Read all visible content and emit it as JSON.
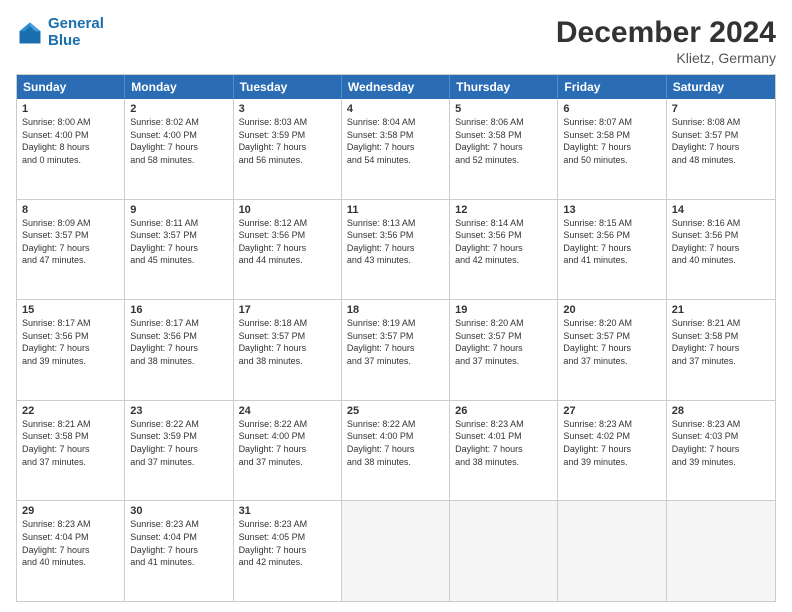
{
  "header": {
    "logo_line1": "General",
    "logo_line2": "Blue",
    "month": "December 2024",
    "location": "Klietz, Germany"
  },
  "days_of_week": [
    "Sunday",
    "Monday",
    "Tuesday",
    "Wednesday",
    "Thursday",
    "Friday",
    "Saturday"
  ],
  "weeks": [
    [
      {
        "day": "1",
        "lines": [
          "Sunrise: 8:00 AM",
          "Sunset: 4:00 PM",
          "Daylight: 8 hours",
          "and 0 minutes."
        ]
      },
      {
        "day": "2",
        "lines": [
          "Sunrise: 8:02 AM",
          "Sunset: 4:00 PM",
          "Daylight: 7 hours",
          "and 58 minutes."
        ]
      },
      {
        "day": "3",
        "lines": [
          "Sunrise: 8:03 AM",
          "Sunset: 3:59 PM",
          "Daylight: 7 hours",
          "and 56 minutes."
        ]
      },
      {
        "day": "4",
        "lines": [
          "Sunrise: 8:04 AM",
          "Sunset: 3:58 PM",
          "Daylight: 7 hours",
          "and 54 minutes."
        ]
      },
      {
        "day": "5",
        "lines": [
          "Sunrise: 8:06 AM",
          "Sunset: 3:58 PM",
          "Daylight: 7 hours",
          "and 52 minutes."
        ]
      },
      {
        "day": "6",
        "lines": [
          "Sunrise: 8:07 AM",
          "Sunset: 3:58 PM",
          "Daylight: 7 hours",
          "and 50 minutes."
        ]
      },
      {
        "day": "7",
        "lines": [
          "Sunrise: 8:08 AM",
          "Sunset: 3:57 PM",
          "Daylight: 7 hours",
          "and 48 minutes."
        ]
      }
    ],
    [
      {
        "day": "8",
        "lines": [
          "Sunrise: 8:09 AM",
          "Sunset: 3:57 PM",
          "Daylight: 7 hours",
          "and 47 minutes."
        ]
      },
      {
        "day": "9",
        "lines": [
          "Sunrise: 8:11 AM",
          "Sunset: 3:57 PM",
          "Daylight: 7 hours",
          "and 45 minutes."
        ]
      },
      {
        "day": "10",
        "lines": [
          "Sunrise: 8:12 AM",
          "Sunset: 3:56 PM",
          "Daylight: 7 hours",
          "and 44 minutes."
        ]
      },
      {
        "day": "11",
        "lines": [
          "Sunrise: 8:13 AM",
          "Sunset: 3:56 PM",
          "Daylight: 7 hours",
          "and 43 minutes."
        ]
      },
      {
        "day": "12",
        "lines": [
          "Sunrise: 8:14 AM",
          "Sunset: 3:56 PM",
          "Daylight: 7 hours",
          "and 42 minutes."
        ]
      },
      {
        "day": "13",
        "lines": [
          "Sunrise: 8:15 AM",
          "Sunset: 3:56 PM",
          "Daylight: 7 hours",
          "and 41 minutes."
        ]
      },
      {
        "day": "14",
        "lines": [
          "Sunrise: 8:16 AM",
          "Sunset: 3:56 PM",
          "Daylight: 7 hours",
          "and 40 minutes."
        ]
      }
    ],
    [
      {
        "day": "15",
        "lines": [
          "Sunrise: 8:17 AM",
          "Sunset: 3:56 PM",
          "Daylight: 7 hours",
          "and 39 minutes."
        ]
      },
      {
        "day": "16",
        "lines": [
          "Sunrise: 8:17 AM",
          "Sunset: 3:56 PM",
          "Daylight: 7 hours",
          "and 38 minutes."
        ]
      },
      {
        "day": "17",
        "lines": [
          "Sunrise: 8:18 AM",
          "Sunset: 3:57 PM",
          "Daylight: 7 hours",
          "and 38 minutes."
        ]
      },
      {
        "day": "18",
        "lines": [
          "Sunrise: 8:19 AM",
          "Sunset: 3:57 PM",
          "Daylight: 7 hours",
          "and 37 minutes."
        ]
      },
      {
        "day": "19",
        "lines": [
          "Sunrise: 8:20 AM",
          "Sunset: 3:57 PM",
          "Daylight: 7 hours",
          "and 37 minutes."
        ]
      },
      {
        "day": "20",
        "lines": [
          "Sunrise: 8:20 AM",
          "Sunset: 3:57 PM",
          "Daylight: 7 hours",
          "and 37 minutes."
        ]
      },
      {
        "day": "21",
        "lines": [
          "Sunrise: 8:21 AM",
          "Sunset: 3:58 PM",
          "Daylight: 7 hours",
          "and 37 minutes."
        ]
      }
    ],
    [
      {
        "day": "22",
        "lines": [
          "Sunrise: 8:21 AM",
          "Sunset: 3:58 PM",
          "Daylight: 7 hours",
          "and 37 minutes."
        ]
      },
      {
        "day": "23",
        "lines": [
          "Sunrise: 8:22 AM",
          "Sunset: 3:59 PM",
          "Daylight: 7 hours",
          "and 37 minutes."
        ]
      },
      {
        "day": "24",
        "lines": [
          "Sunrise: 8:22 AM",
          "Sunset: 4:00 PM",
          "Daylight: 7 hours",
          "and 37 minutes."
        ]
      },
      {
        "day": "25",
        "lines": [
          "Sunrise: 8:22 AM",
          "Sunset: 4:00 PM",
          "Daylight: 7 hours",
          "and 38 minutes."
        ]
      },
      {
        "day": "26",
        "lines": [
          "Sunrise: 8:23 AM",
          "Sunset: 4:01 PM",
          "Daylight: 7 hours",
          "and 38 minutes."
        ]
      },
      {
        "day": "27",
        "lines": [
          "Sunrise: 8:23 AM",
          "Sunset: 4:02 PM",
          "Daylight: 7 hours",
          "and 39 minutes."
        ]
      },
      {
        "day": "28",
        "lines": [
          "Sunrise: 8:23 AM",
          "Sunset: 4:03 PM",
          "Daylight: 7 hours",
          "and 39 minutes."
        ]
      }
    ],
    [
      {
        "day": "29",
        "lines": [
          "Sunrise: 8:23 AM",
          "Sunset: 4:04 PM",
          "Daylight: 7 hours",
          "and 40 minutes."
        ]
      },
      {
        "day": "30",
        "lines": [
          "Sunrise: 8:23 AM",
          "Sunset: 4:04 PM",
          "Daylight: 7 hours",
          "and 41 minutes."
        ]
      },
      {
        "day": "31",
        "lines": [
          "Sunrise: 8:23 AM",
          "Sunset: 4:05 PM",
          "Daylight: 7 hours",
          "and 42 minutes."
        ]
      },
      {
        "day": "",
        "lines": []
      },
      {
        "day": "",
        "lines": []
      },
      {
        "day": "",
        "lines": []
      },
      {
        "day": "",
        "lines": []
      }
    ]
  ]
}
